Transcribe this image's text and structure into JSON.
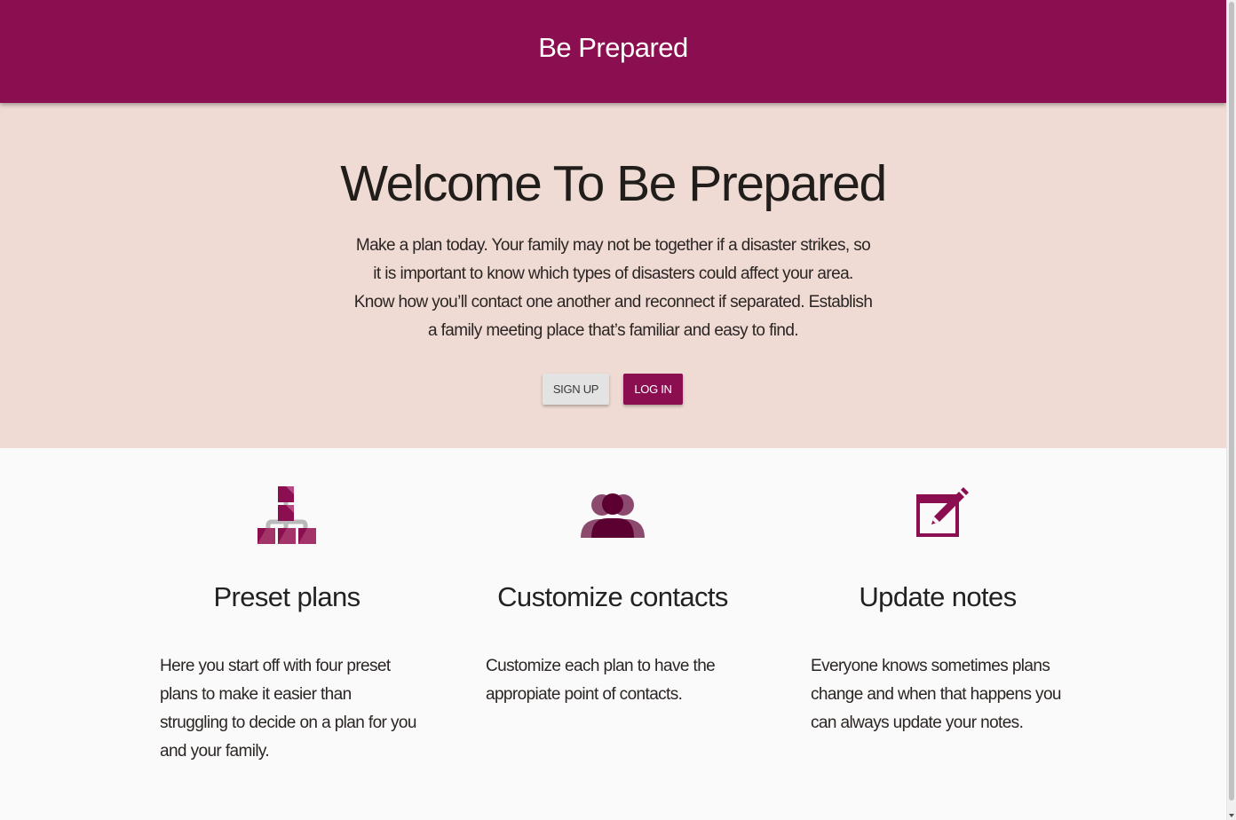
{
  "header": {
    "brand": "Be Prepared"
  },
  "hero": {
    "title": "Welcome To Be Prepared",
    "text": "Make a plan today. Your family may not be together if a disaster strikes, so it is important to know which types of disasters could affect your area. Know how you’ll contact one another and reconnect if separated. Establish a family meeting place that’s familiar and easy to find.",
    "signup_label": "Sign up",
    "login_label": "Log in"
  },
  "features": [
    {
      "icon": "hierarchy-blocks-icon",
      "title": "Preset plans",
      "text": "Here you start off with four preset plans to make it easier than struggling to decide on a plan for you and your family."
    },
    {
      "icon": "group-people-icon",
      "title": "Customize contacts",
      "text": "Customize each plan to have the appropiate point of contacts."
    },
    {
      "icon": "edit-note-icon",
      "title": "Update notes",
      "text": "Everyone knows sometimes plans change and when that happens you can always update your notes."
    }
  ],
  "colors": {
    "primary": "#8b0e50",
    "hero_bg": "#efdbd4",
    "page_bg": "#fafafa",
    "icon_dark": "#5b0030"
  }
}
